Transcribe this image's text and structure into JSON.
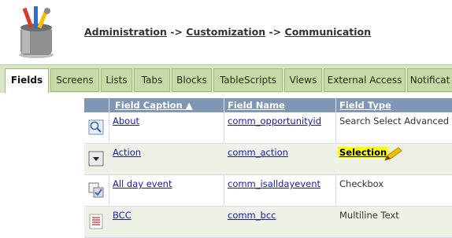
{
  "breadcrumb": {
    "items": [
      "Administration",
      "Customization",
      "Communication"
    ],
    "separator": "->"
  },
  "tabs": [
    {
      "label": "Fields",
      "active": true
    },
    {
      "label": "Screens",
      "active": false
    },
    {
      "label": "Lists",
      "active": false
    },
    {
      "label": "Tabs",
      "active": false
    },
    {
      "label": "Blocks",
      "active": false
    },
    {
      "label": "TableScripts",
      "active": false
    },
    {
      "label": "Views",
      "active": false
    },
    {
      "label": "External Access",
      "active": false
    },
    {
      "label": "Notificat",
      "active": false
    }
  ],
  "table": {
    "headers": {
      "caption": "Field Caption ▲",
      "name": "Field Name",
      "type": "Field Type"
    },
    "rows": [
      {
        "icon": "search-select-icon",
        "caption": "About",
        "name": "comm_opportunityid",
        "type": "Search Select Advanced"
      },
      {
        "icon": "dropdown-icon",
        "caption": "Action",
        "name": "comm_action",
        "type": "Selection"
      },
      {
        "icon": "checkbox-icon",
        "caption": "All day event",
        "name": "comm_isalldayevent",
        "type": "Checkbox"
      },
      {
        "icon": "multiline-icon",
        "caption": "BCC",
        "name": "comm_bcc",
        "type": "Multiline Text"
      }
    ]
  },
  "colors": {
    "tab_bar": "#d9e6c3",
    "tab": "#c6d9a6",
    "header_row": "#7f96b5",
    "link": "#1a1aa6",
    "highlight": "#ffff00"
  }
}
